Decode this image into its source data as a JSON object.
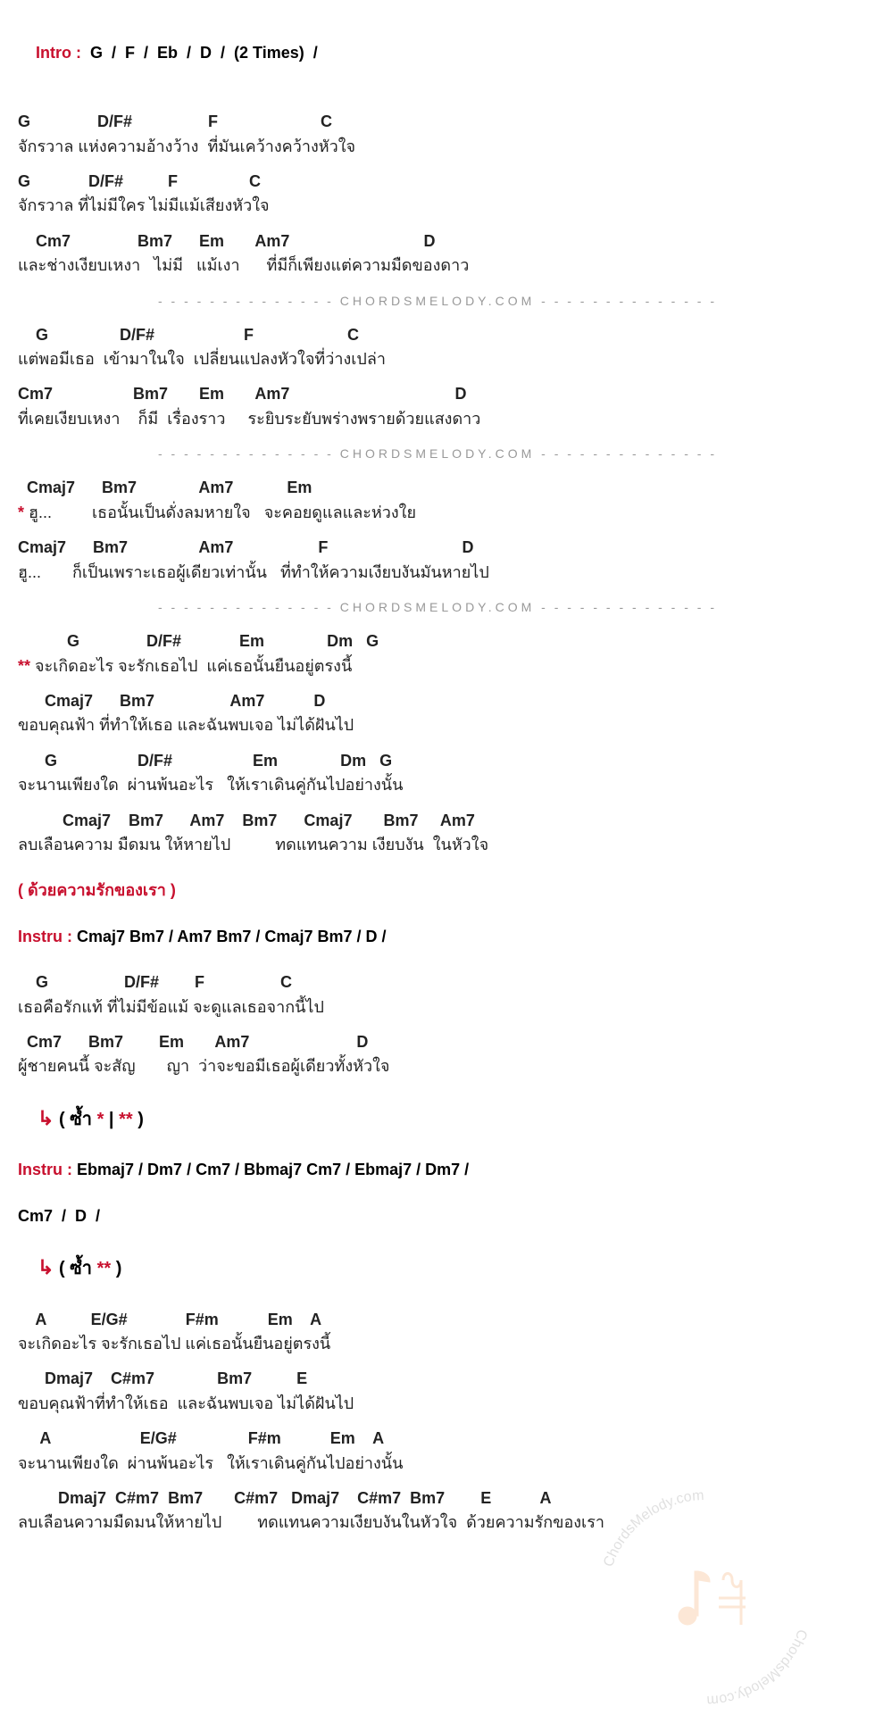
{
  "intro": {
    "label": "Intro :",
    "chords": "G  /  F  /  Eb  /  D  /  (2 Times)  /"
  },
  "divider_brand": "CHORDSMELODY.COM",
  "verse1": {
    "l1c": "G               D/F#                 F                       C",
    "l1t": "จักรวาล แห่งความอ้างว้าง  ที่มันเคว้างคว้างหัวใจ",
    "l2c": "G             D/F#          F                C",
    "l2t": "จักรวาล ที่ไม่มีใคร ไม่มีแม้เสียงหัวใจ",
    "l3c": "    Cm7               Bm7      Em       Am7                              D",
    "l3t": "และช่างเงียบเหงา   ไม่มี   แม้เงา      ที่มีก็เพียงแต่ความมืดของดาว"
  },
  "verse2": {
    "l1c": "    G                D/F#                    F                     C",
    "l1t": "แต่พอมีเธอ  เข้ามาในใจ  เปลี่ยนแปลงหัวใจที่ว่างเปล่า",
    "l2c": "Cm7                  Bm7       Em       Am7                                     D",
    "l2t": "ที่เคยเงียบเหงา    ก็มี  เรื่องราว     ระยิบระยับพร่างพรายด้วยแสงดาว"
  },
  "pre": {
    "l1c": "  Cmaj7      Bm7              Am7            Em",
    "l1m": "*",
    "l1t": " ฮู...         เธอนั้นเป็นดั่งลมหายใจ   จะคอยดูแลและห่วงใย",
    "l2c": "Cmaj7      Bm7                Am7                   F                              D",
    "l2t": "ฮู...       ก็เป็นเพราะเธอผู้เดียวเท่านั้น   ที่ทำให้ความเงียบงันมันหายไป"
  },
  "chorus": {
    "l1c": "           G               D/F#             Em              Dm   G",
    "l1m": "**",
    "l1t": " จะเกิดอะไร จะรักเธอไป  แค่เธอนั้นยืนอยู่ตรงนี้",
    "l2c": "      Cmaj7      Bm7                 Am7           D",
    "l2t": "ขอบคุณฟ้า ที่ทำให้เธอ และฉันพบเจอ ไม่ได้ฝันไป",
    "l3c": "      G                  D/F#                  Em              Dm   G",
    "l3t": "จะนานเพียงใด  ผ่านพ้นอะไร   ให้เราเดินคู่กันไปอย่างนั้น",
    "l4c": "          Cmaj7    Bm7      Am7    Bm7      Cmaj7       Bm7     Am7",
    "l4t": "ลบเลือนความ มืดมน ให้หายไป          ทดแทนความ เงียบงัน  ในหัวใจ"
  },
  "note1": "( ด้วยความรักของเรา )",
  "instru1": {
    "label": "Instru :",
    "chords": "Cmaj7  Bm7  /  Am7  Bm7  /  Cmaj7  Bm7  /  D  /"
  },
  "verse3": {
    "l1c": "    G                 D/F#        F                 C",
    "l1t": "เธอคือรักแท้ ที่ไม่มีข้อแม้ จะดูแลเธอจากนี้ไป",
    "l2c": "  Cm7      Bm7        Em       Am7                        D",
    "l2t": "ผู้ชายคนนี้ จะสัญ       ญา  ว่าจะขอมีเธอผู้เดียวทั้งหัวใจ"
  },
  "repeat1": {
    "arrow": "↳",
    "text": "( ซ้ำ ",
    "m1": "*",
    "sep": " | ",
    "m2": "**",
    "end": " )"
  },
  "instru2": {
    "label": "Instru :",
    "chords1": "Ebmaj7  /  Dm7  /  Cm7  /  Bbmaj7  Cm7  /  Ebmaj7  /  Dm7  /",
    "chords2": "Cm7  /  D  /"
  },
  "repeat2": {
    "arrow": "↳",
    "text": "( ซ้ำ ",
    "m1": "**",
    "end": " )"
  },
  "outro": {
    "l1c": "    A          E/G#             F#m           Em    A",
    "l1t": "จะเกิดอะไร จะรักเธอไป แค่เธอนั้นยืนอยู่ตรงนี้",
    "l2c": "      Dmaj7    C#m7              Bm7          E",
    "l2t": "ขอบคุณฟ้าที่ทำให้เธอ  และฉันพบเจอ ไม่ได้ฝันไป",
    "l3c": "     A                    E/G#                F#m           Em    A",
    "l3t": "จะนานเพียงใด  ผ่านพ้นอะไร   ให้เราเดินคู่กันไปอย่างนั้น",
    "l4c": "         Dmaj7  C#m7  Bm7       C#m7   Dmaj7    C#m7  Bm7        E           A",
    "l4t": "ลบเลือนความมืดมนให้หายไป        ทดแทนความเงียบงันในหัวใจ  ด้วยความรักของเรา"
  },
  "watermark_text": "ChordsMelody.com"
}
